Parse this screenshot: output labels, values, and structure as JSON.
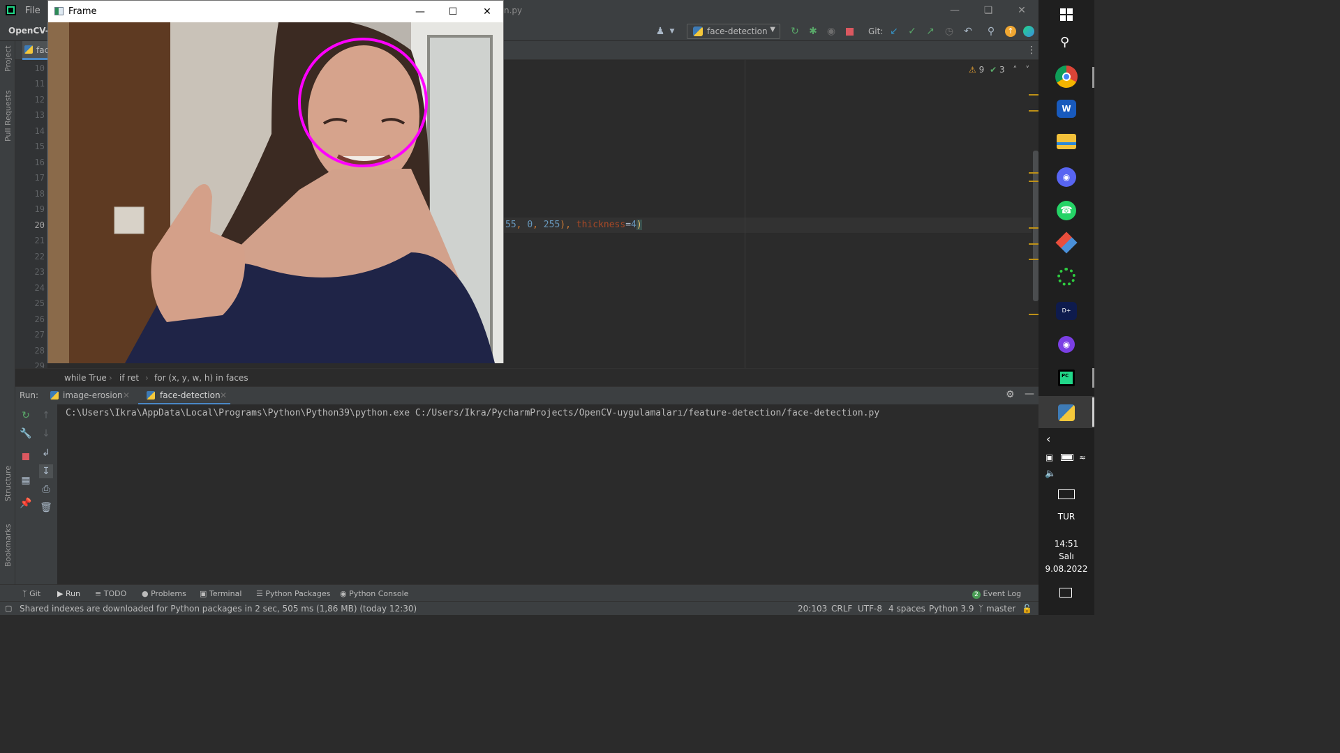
{
  "ide": {
    "menu_file": "File",
    "title_tail": "n.py",
    "project_name": "OpenCV-u",
    "run_config": "face-detection",
    "git_label": "Git:",
    "file_tab_partial": "fac",
    "inspection_warnings": "9",
    "inspection_ok": "3",
    "left_tabs": [
      "Project",
      "Pull Requests",
      "Structure",
      "Bookmarks"
    ],
    "line_numbers": [
      "10",
      "11",
      "12",
      "13",
      "14",
      "15",
      "16",
      "17",
      "18",
      "19",
      "20",
      "21",
      "22",
      "23",
      "24",
      "25",
      "26",
      "27",
      "28",
      "29"
    ],
    "code_line_20": {
      "num_a": "55",
      "sep1": ", ",
      "num_b": "0",
      "sep2": ", ",
      "num_c": "255",
      "close": "), ",
      "kw": "thickness",
      "eq": "=",
      "num_d": "4",
      "end": ")"
    },
    "breadcrumb": [
      "while True",
      "if ret",
      "for (x, y, w, h) in faces"
    ],
    "run": {
      "label": "Run:",
      "tabs": [
        "image-erosion",
        "face-detection"
      ],
      "command": "C:\\Users\\Ikra\\AppData\\Local\\Programs\\Python\\Python39\\python.exe C:/Users/Ikra/PycharmProjects/OpenCV-uygulamaları/feature-detection/face-detection.py"
    },
    "bottom_tools": [
      "Git",
      "Run",
      "TODO",
      "Problems",
      "Terminal",
      "Python Packages",
      "Python Console"
    ],
    "event_log_count": "2",
    "event_log": "Event Log",
    "status_message": "Shared indexes are downloaded for Python packages in 2 sec, 505 ms (1,86 MB) (today 12:30)",
    "status": {
      "position": "20:103",
      "line_sep": "CRLF",
      "encoding": "UTF-8",
      "indent": "4 spaces",
      "interpreter": "Python 3.9",
      "branch": "master"
    },
    "colors": {
      "editor_bg": "#2b2b2b",
      "panel_bg": "#3c3f41",
      "number": "#6897bb",
      "keyword_arg": "#aa4926",
      "warning": "#be9117"
    }
  },
  "cv_window": {
    "title": "Frame",
    "circle_color": "#ff00ff"
  },
  "taskbar": {
    "apps": [
      "windows-start",
      "search",
      "chrome",
      "word",
      "file-explorer",
      "discord",
      "whatsapp",
      "git-extensions",
      "app-green-ring",
      "disney-plus",
      "github-desktop",
      "pycharm",
      "python"
    ],
    "language": "TUR",
    "time": "14:51",
    "day": "Salı",
    "date": "9.08.2022"
  }
}
